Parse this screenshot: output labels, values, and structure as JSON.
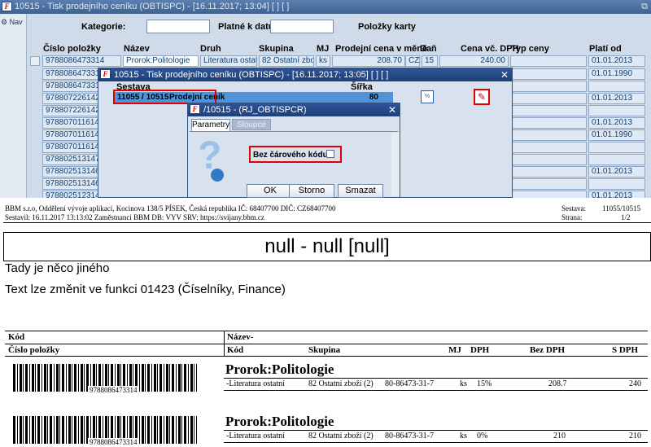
{
  "app": {
    "title": "10515 - Tisk prodejního ceníku (OBTISPC) - [16.11.2017; 13:04] [ ] [ ]",
    "nav_label": "Nav",
    "filters": {
      "kategorie_label": "Kategorie:",
      "platne_label": "Platné k datu:",
      "polozky_label": "Položky karty"
    },
    "columns": [
      "Číslo položky",
      "Název",
      "Druh",
      "Skupina",
      "MJ",
      "Prodejní cena v měně",
      "Daň",
      "Cena vč. DPH",
      "Typ ceny",
      "Platí od"
    ],
    "first_row": {
      "cislo": "9788086473314",
      "nazev": "Prorok:Politologie",
      "druh": "Literatura ostatní",
      "skupina": "82 Ostatní zboží (2)",
      "mj": "ks",
      "cena": "208.70",
      "mena": "CZK",
      "dan": "15",
      "cena_dph": "240.00",
      "plati_od": "01.01.2013"
    },
    "rows": [
      {
        "cislo": "9788086473314",
        "plati_od": "01.01.1990"
      },
      {
        "cislo": "9788086473314",
        "plati_od": ""
      },
      {
        "cislo": "9788072261420",
        "plati_od": "01.01.2013"
      },
      {
        "cislo": "9788072261420",
        "plati_od": ""
      },
      {
        "cislo": "9788070116142",
        "plati_od": "01.01.2013"
      },
      {
        "cislo": "9788070116142",
        "plati_od": "01.01.1990"
      },
      {
        "cislo": "9788070116142",
        "plati_od": ""
      },
      {
        "cislo": "9788025131473",
        "plati_od": ""
      },
      {
        "cislo": "9788025131466",
        "plati_od": "01.01.2013"
      },
      {
        "cislo": "9788025131466",
        "plati_od": ""
      },
      {
        "cislo": "9788025123140",
        "plati_od": "01.01.2013"
      }
    ]
  },
  "dialog1": {
    "title": "10515 - Tisk prodejního ceníku (OBTISPC) - [16.11.2017; 13:05] [ ] [ ]",
    "sestava_label": "Sestava",
    "sirka_label": "Šířka",
    "sestava_value": "11055 / 10515",
    "sestava_name": "Prodejní ceník",
    "sirka_value": "80"
  },
  "dialog2": {
    "title": "/10515 - (RJ_OBTISPCR)",
    "tabs": [
      "Parametry",
      "Sloupce"
    ],
    "checkbox_label": "Bez čárového kódu:",
    "ok": "OK",
    "storno": "Storno",
    "smazat": "Smazat"
  },
  "report": {
    "company": "BBM s.r.o, Oddělení vývoje aplikací, Kocinova 138/5 PÍSEK, Česká republika  IČ: 68407700  DIČ: CZ68407700",
    "compiled": "Sestavil: 16.11.2017 13:13:02 Zaměstnanci BBM  DB: VYV  SRV: https://svijany.bbm.cz",
    "sestava_label": "Sestava:",
    "sestava_value": "11055/10515",
    "strana_label": "Strana:",
    "strana_value": "1/2",
    "heading": "null - null  [null]",
    "note1": "Tady je něco jiného",
    "note2": "Text lze změnit ve funkci 01423 (Číselníky, Finance)",
    "hdr_kod": "Kód",
    "hdr_nazev": "Název-",
    "hdr_cislo": "Číslo položky",
    "hdr_cols": [
      "Kód",
      "Skupina",
      "MJ",
      "DPH",
      "Bez DPH",
      "S DPH"
    ],
    "items": [
      {
        "barcode": "9788086473314",
        "name": "Prorok:Politologie",
        "kod": "-Literatura ostatní",
        "skupina": "82 Ostatní zboží (2)",
        "isbn": "80-86473-31-7",
        "mj": "ks",
        "dph": "15%",
        "bez": "208.7",
        "s": "240"
      },
      {
        "barcode": "9788086473314",
        "name": "Prorok:Politologie",
        "kod": "-Literatura ostatní",
        "skupina": "82 Ostatní zboží (2)",
        "isbn": "80-86473-31-7",
        "mj": "ks",
        "dph": "0%",
        "bez": "210",
        "s": "210"
      }
    ]
  }
}
